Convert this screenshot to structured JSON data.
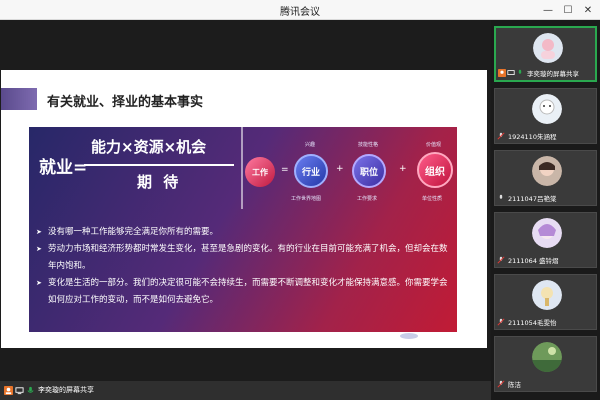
{
  "window": {
    "title": "腾讯会议"
  },
  "slide": {
    "header_title": "有关就业、择业的基本事实",
    "formula": {
      "left": "就业=",
      "top": "能力×资源×机会",
      "bottom": "期  待"
    },
    "diagram": {
      "work": "工作",
      "eq": "=",
      "plus": "+",
      "industry": "行业",
      "position": "职位",
      "org": "组织",
      "label_interest": "兴趣",
      "label_skill": "技能性格",
      "label_value": "价值观",
      "label_world": "工作世界地图",
      "label_req": "工作要求",
      "label_unit": "单位性质"
    },
    "bullets": [
      "没有哪一种工作能够完全满足你所有的需要。",
      "劳动力市场和经济形势都时常发生变化，甚至是急剧的变化。有的行业在目前可能充满了机会，但却会在数年内饱和。",
      "变化是生活的一部分。我们的决定很可能不会持续生，而需要不断调整和变化才能保持满意感。你需要学会如何应对工作的变动，而不是如何去避免它。"
    ]
  },
  "bottom_bar": {
    "share_label": "李奕璇的屏幕共享"
  },
  "participants": [
    {
      "name": "李奕璇的屏幕共享",
      "active": true
    },
    {
      "name": "1924110朱涵程",
      "active": false
    },
    {
      "name": "2111047吕艳棠",
      "active": false
    },
    {
      "name": "2111064 盛铃熠",
      "active": false
    },
    {
      "name": "2111054毛雯怡",
      "active": false
    },
    {
      "name": "陈洁",
      "active": false
    }
  ],
  "colors": {
    "accent_green": "#2aa84f",
    "banner_start": "#272868",
    "banner_end": "#c11b35"
  }
}
